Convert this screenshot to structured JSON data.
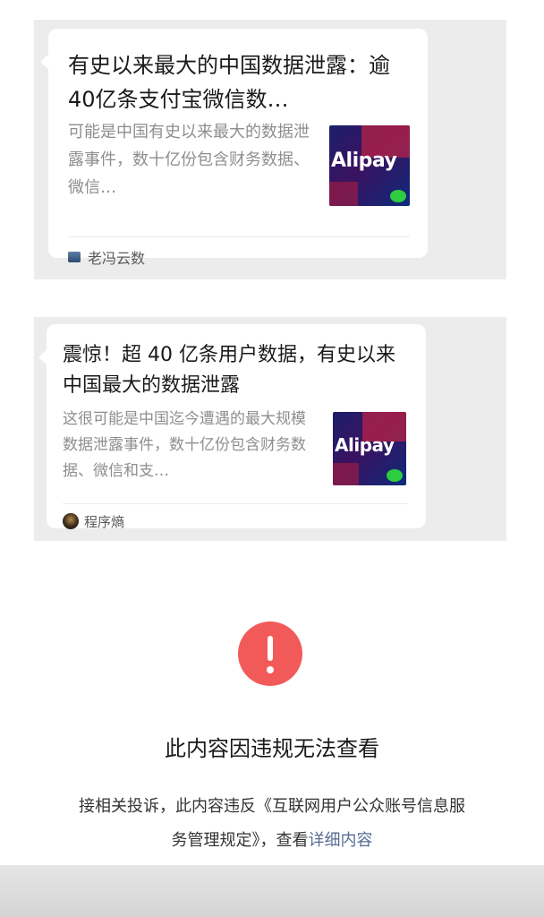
{
  "articles": [
    {
      "title": "有史以来最大的中国数据泄露：逾40亿条支付宝微信数…",
      "description": "可能是中国有史以来最大的数据泄露事件，数十亿份包含财务数据、微信…",
      "thumbnail_text": "Alipay",
      "source": "老冯云数"
    },
    {
      "title": "震惊！超 40 亿条用户数据，有史以来中国最大的数据泄露",
      "description": "这很可能是中国迄今遭遇的最大规模数据泄露事件，数十亿份包含财务数据、微信和支…",
      "thumbnail_text": "Alipay",
      "source": "程序熵"
    }
  ],
  "blocked": {
    "icon": "exclamation-icon",
    "title": "此内容因违规无法查看",
    "description_prefix": "接相关投诉，此内容违反《互联网用户公众账号信息服务管理规定》，查看",
    "link_text": "详细内容"
  },
  "colors": {
    "error_red": "#f25a5a",
    "link_blue": "#576b95",
    "chat_background": "#ececec"
  }
}
